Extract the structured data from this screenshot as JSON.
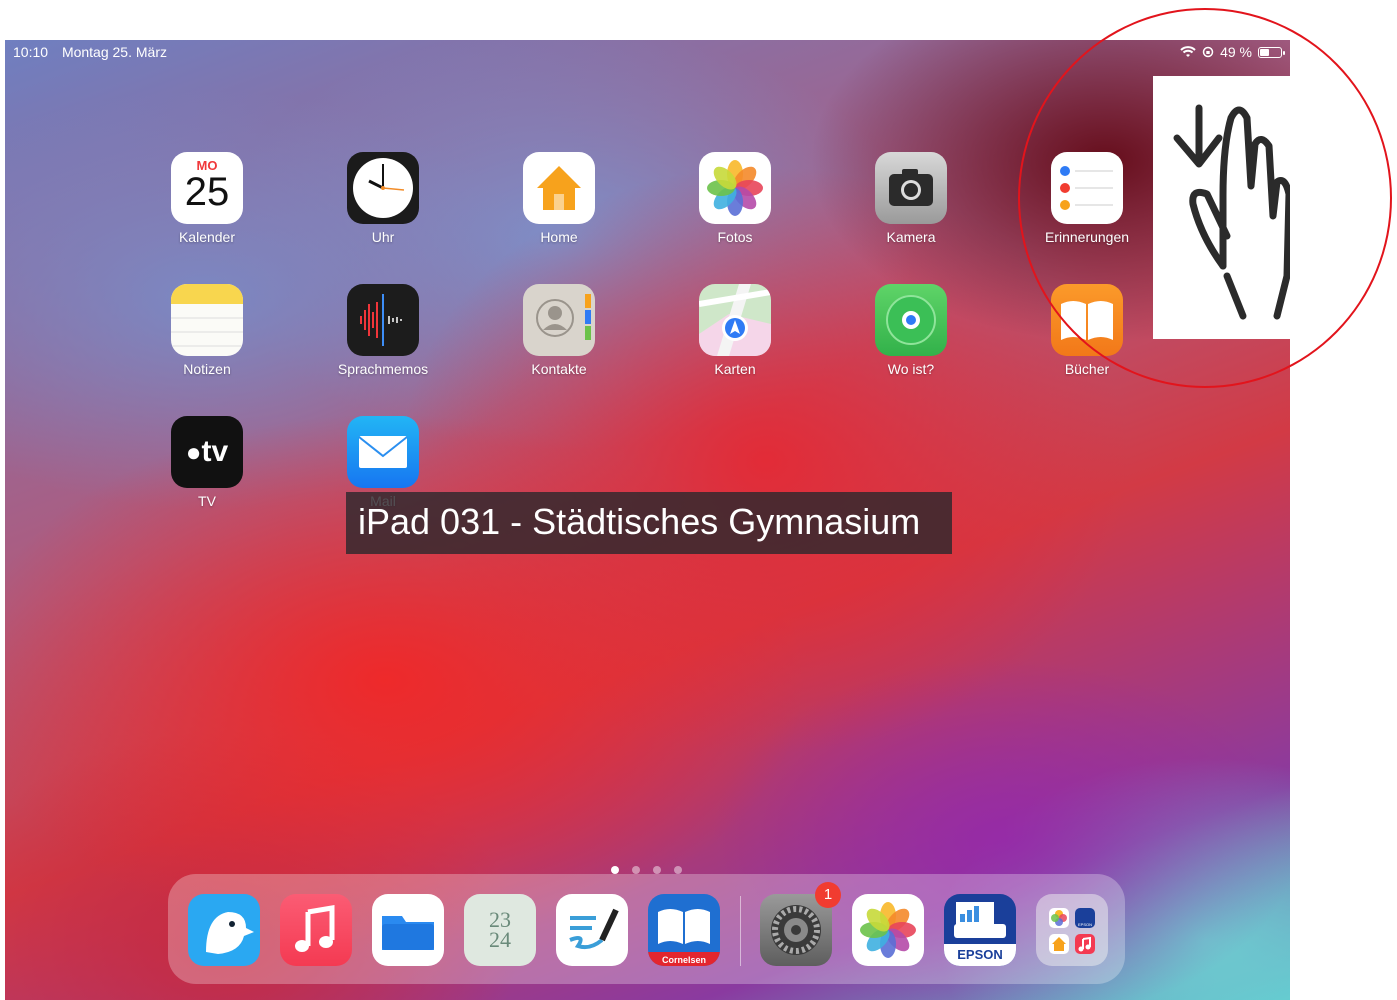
{
  "status_bar": {
    "time": "10:10",
    "date": "Montag 25. März",
    "battery_percent": "49 %",
    "battery_level": 0.49
  },
  "apps": [
    {
      "label": "Kalender",
      "icon": "calendar-icon",
      "calendar_day": "MO",
      "calendar_date": "25"
    },
    {
      "label": "Uhr",
      "icon": "clock-icon"
    },
    {
      "label": "Home",
      "icon": "home-icon"
    },
    {
      "label": "Fotos",
      "icon": "photos-icon"
    },
    {
      "label": "Kamera",
      "icon": "camera-icon"
    },
    {
      "label": "Erinnerungen",
      "icon": "reminders-icon"
    },
    {
      "label": "Notizen",
      "icon": "notes-icon"
    },
    {
      "label": "Sprachmemos",
      "icon": "voice-memos-icon"
    },
    {
      "label": "Kontakte",
      "icon": "contacts-icon"
    },
    {
      "label": "Karten",
      "icon": "maps-icon"
    },
    {
      "label": "Wo ist?",
      "icon": "find-my-icon"
    },
    {
      "label": "Bücher",
      "icon": "books-icon"
    },
    {
      "label": "TV",
      "icon": "tv-icon",
      "icon_text": "tv"
    },
    {
      "label": "Mail",
      "icon": "mail-icon"
    }
  ],
  "overlay_text": "iPad 031 - Städtisches Gymnasium",
  "page_dots": {
    "count": 4,
    "active": 0
  },
  "dock": [
    {
      "name": "bird-app-icon"
    },
    {
      "name": "music-icon"
    },
    {
      "name": "files-icon"
    },
    {
      "name": "planner-icon",
      "text_top": "23",
      "text_bottom": "24"
    },
    {
      "name": "notes-pen-icon"
    },
    {
      "name": "cornelsen-book-icon",
      "text": "Cornelsen"
    },
    {
      "name": "settings-icon",
      "badge": "1"
    },
    {
      "name": "photos-icon"
    },
    {
      "name": "epson-icon",
      "text": "EPSON"
    },
    {
      "name": "app-library-icon",
      "text": "EPSON"
    }
  ],
  "colors": {
    "annotation_red": "#e2141c",
    "status_text": "#ffffff"
  }
}
